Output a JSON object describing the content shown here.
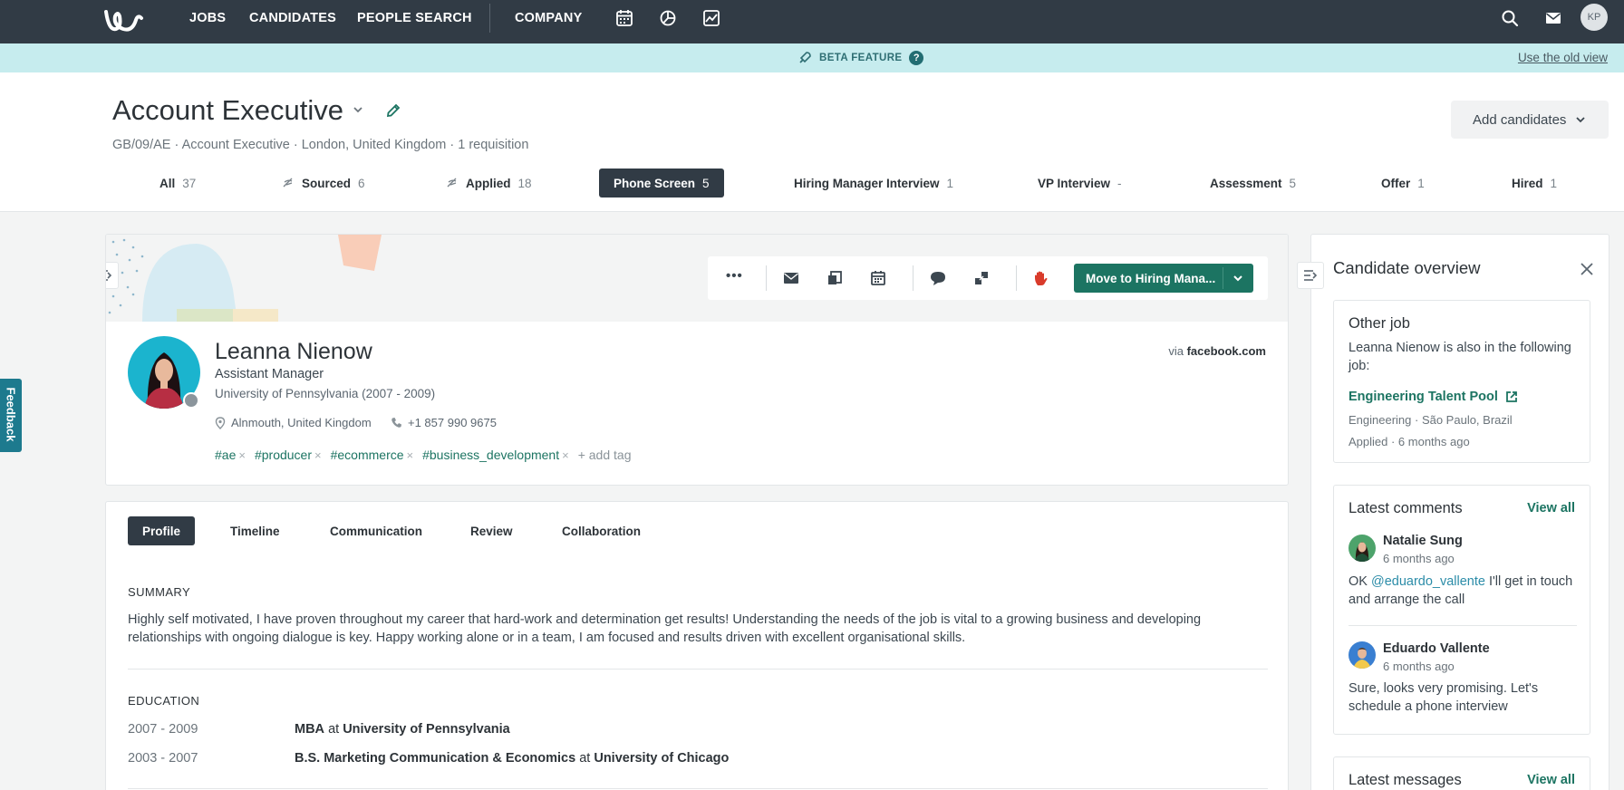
{
  "nav": {
    "items": [
      "JOBS",
      "CANDIDATES",
      "PEOPLE SEARCH",
      "COMPANY"
    ],
    "icons": [
      "calendar-icon",
      "pie-chart-icon",
      "activity-icon",
      "search-icon",
      "mail-icon"
    ],
    "user_initials": "KP"
  },
  "beta": {
    "label": "BETA FEATURE",
    "help": "?",
    "old_view": "Use the old view"
  },
  "job": {
    "title": "Account Executive",
    "subtitle": "GB/09/AE · Account Executive · London, United Kingdom · 1 requisition",
    "add_candidates": "Add candidates"
  },
  "stages": [
    {
      "label": "All",
      "count": "37"
    },
    {
      "label": "Sourced",
      "count": "6"
    },
    {
      "label": "Applied",
      "count": "18"
    },
    {
      "label": "Phone Screen",
      "count": "5"
    },
    {
      "label": "Hiring Manager Interview",
      "count": "1"
    },
    {
      "label": "VP Interview",
      "count": "-"
    },
    {
      "label": "Assessment",
      "count": "5"
    },
    {
      "label": "Offer",
      "count": "1"
    },
    {
      "label": "Hired",
      "count": "1"
    }
  ],
  "toolbar": {
    "more": "•••",
    "move_label": "Move to Hiring Mana..."
  },
  "candidate": {
    "name": "Leanna Nienow",
    "role": "Assistant Manager",
    "education": "University of Pennsylvania (2007 - 2009)",
    "location": "Alnmouth, United Kingdom",
    "phone": "+1 857 990 9675",
    "via_prefix": "via",
    "via_source": "facebook.com",
    "tags": [
      "#ae",
      "#producer",
      "#ecommerce",
      "#business_development"
    ],
    "tag_remove": "×",
    "add_tag": "+  add tag"
  },
  "profile_tabs": [
    "Profile",
    "Timeline",
    "Communication",
    "Review",
    "Collaboration"
  ],
  "profile": {
    "summary_head": "SUMMARY",
    "summary": "Highly self motivated, I have proven throughout my career that hard-work and determination get results! Understanding the needs of the job is vital to a growing business and developing relationships with ongoing dialogue is key. Happy working alone or in a team, I am focused and results driven with excellent organisational skills.",
    "education_head": "EDUCATION",
    "education": [
      {
        "years": "2007 - 2009",
        "degree": "MBA",
        "at": "at",
        "school": "University of Pennsylvania"
      },
      {
        "years": "2003 - 2007",
        "degree": "B.S. Marketing Communication & Economics",
        "at": "at",
        "school": "University of Chicago"
      }
    ]
  },
  "feedback": "Feedback",
  "overview": {
    "title": "Candidate overview",
    "other_job": {
      "heading": "Other job",
      "text": "Leanna Nienow is also in the following job:",
      "job_link": "Engineering Talent Pool",
      "job_meta": "Engineering · São Paulo, Brazil",
      "applied": "Applied · 6 months ago"
    },
    "comments": {
      "heading": "Latest comments",
      "view_all": "View all",
      "items": [
        {
          "name": "Natalie Sung",
          "time": "6 months ago",
          "mention": "@eduardo_vallente",
          "text_before": "OK ",
          "text_after": " I'll get in touch and arrange the call"
        },
        {
          "name": "Eduardo Vallente",
          "time": "6 months ago",
          "text": "Sure, looks very promising. Let's schedule a phone interview"
        }
      ]
    },
    "messages": {
      "heading": "Latest messages",
      "view_all": "View all"
    }
  },
  "colors": {
    "nav_bg": "#313b45",
    "accent": "#1c7462",
    "beta_bg": "#c6ecee",
    "avatar_bg": "#1bb4ce"
  }
}
